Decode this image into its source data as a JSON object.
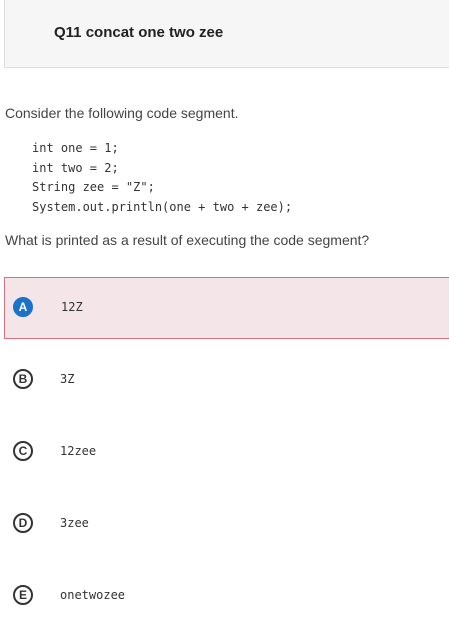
{
  "header": {
    "title": "Q11 concat one two zee"
  },
  "prompt": "Consider the following code segment.",
  "code": [
    "int one = 1;",
    "int two = 2;",
    "String zee = \"Z\";",
    "System.out.println(one + two + zee);"
  ],
  "question": "What is printed as a result of executing the code segment?",
  "choices": [
    {
      "letter": "A",
      "text": "12Z"
    },
    {
      "letter": "B",
      "text": "3Z"
    },
    {
      "letter": "C",
      "text": "12zee"
    },
    {
      "letter": "D",
      "text": "3zee"
    },
    {
      "letter": "E",
      "text": "onetwozee"
    }
  ],
  "selected_choice": "A",
  "colors": {
    "selected_background": "#f4e6e8",
    "selected_border": "#d9707f",
    "selected_badge": "#1a73c8"
  }
}
